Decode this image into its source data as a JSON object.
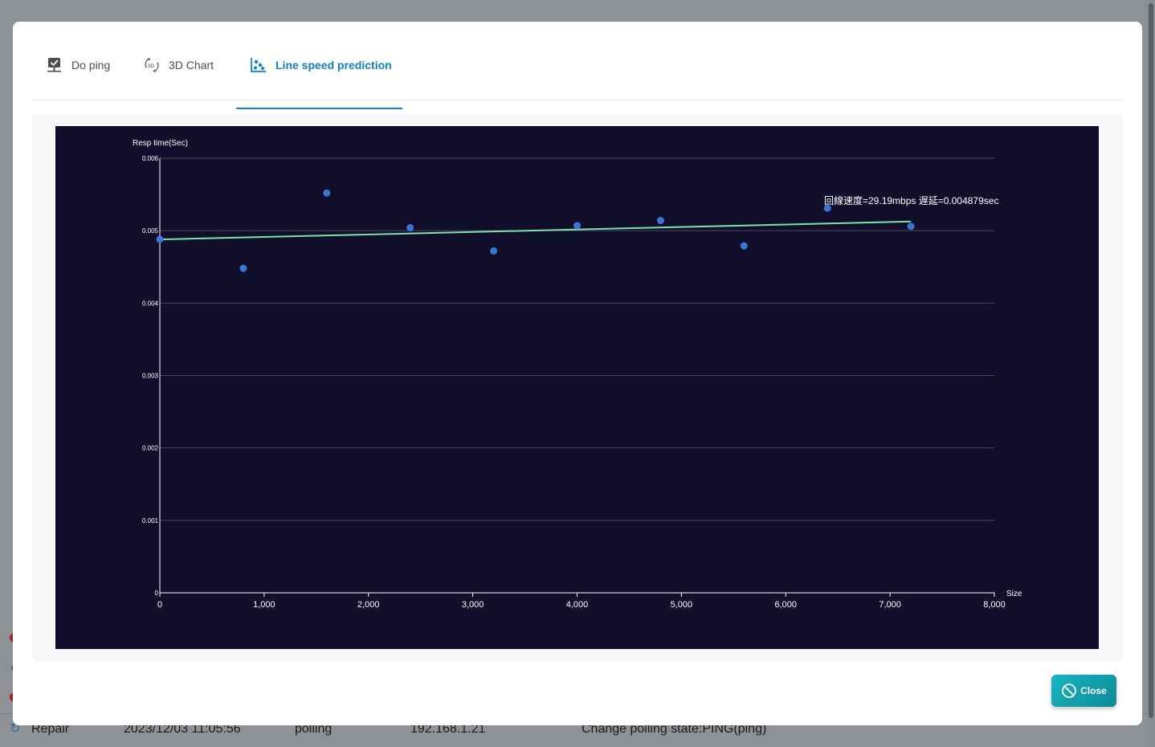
{
  "background": {
    "rows": [
      {
        "status": "Repair",
        "time": "2023/12/03 11:05:56",
        "type": "polling",
        "ip": "192.168.1.21",
        "message": "Change polling state:PING(ping)"
      }
    ]
  },
  "modal": {
    "tabs": [
      {
        "label": "Do ping",
        "icon": "ping-monitor-icon"
      },
      {
        "label": "3D Chart",
        "icon": "3d-rotate-icon"
      },
      {
        "label": "Line speed prediction",
        "icon": "scatter-chart-icon"
      }
    ],
    "active_tab": 2,
    "close_label": "Close"
  },
  "colors": {
    "accent": "#1282c8",
    "chart_bg": "#110e2b",
    "point": "#3b74d4",
    "regression": "#7ce3a8",
    "close_button": "#12a3b0"
  },
  "chart_data": {
    "type": "scatter",
    "ylabel": "Resp time(Sec)",
    "xlabel": "Size",
    "xlim": [
      0,
      8000
    ],
    "ylim": [
      0,
      0.006
    ],
    "x_ticks": [
      0,
      1000,
      2000,
      3000,
      4000,
      5000,
      6000,
      7000,
      8000
    ],
    "x_tick_labels": [
      "0",
      "1,000",
      "2,000",
      "3,000",
      "4,000",
      "5,000",
      "6,000",
      "7,000",
      "8,000"
    ],
    "y_ticks": [
      0,
      0.001,
      0.002,
      0.003,
      0.004,
      0.005,
      0.006
    ],
    "y_tick_labels": [
      "0",
      "0.001",
      "0.002",
      "0.003",
      "0.004",
      "0.005",
      "0.006"
    ],
    "grid": true,
    "points": [
      {
        "x": 0,
        "y": 0.00488
      },
      {
        "x": 800,
        "y": 0.00448
      },
      {
        "x": 1600,
        "y": 0.00552
      },
      {
        "x": 2400,
        "y": 0.00504
      },
      {
        "x": 3200,
        "y": 0.00472
      },
      {
        "x": 4000,
        "y": 0.00507
      },
      {
        "x": 4800,
        "y": 0.00514
      },
      {
        "x": 5600,
        "y": 0.00479
      },
      {
        "x": 6400,
        "y": 0.00531
      },
      {
        "x": 7200,
        "y": 0.00506
      }
    ],
    "regression_line": {
      "x": [
        0,
        7200
      ],
      "y": [
        0.004879,
        0.005126
      ]
    },
    "annotation": "回線速度=29.19mbps 遅延=0.004879sec"
  }
}
